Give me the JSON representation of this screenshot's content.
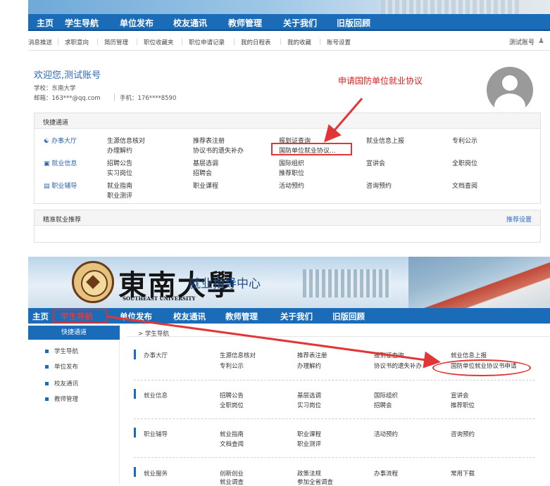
{
  "top": {
    "nav": [
      "主页",
      "学生导航",
      "单位发布",
      "校友通讯",
      "教师管理",
      "关于我们",
      "旧版回顾"
    ],
    "subnav": [
      "消息推送",
      "求职意向",
      "简历管理",
      "职位收藏夹",
      "职位申请记录",
      "我的日程表",
      "我的收藏",
      "账号设置"
    ],
    "account": "测试账号",
    "welcome": "欢迎您,测试账号",
    "school": "学校：东南大学",
    "email": "邮箱：163***@qq.com",
    "phone": "手机：176****8590",
    "annotation": "申请国防单位就业协议",
    "quick": {
      "title": "快捷通道",
      "row1_title": "办事大厅",
      "row1_col1": [
        "生源信息核对",
        "办理解约"
      ],
      "row1_col2": [
        "推荐表注册",
        "协议书的遗失补办"
      ],
      "row1_col3": [
        "报到证查询",
        "国防单位就业协议..."
      ],
      "row1_col4": "就业信息上报",
      "row1_col5": "专利公示",
      "row2_title": "就业信息",
      "row2_col1": [
        "招聘公告",
        "实习岗位"
      ],
      "row2_col2": [
        "基层选调",
        "招聘会"
      ],
      "row2_col3": [
        "国际组织",
        "推荐职位"
      ],
      "row2_col4": "宣讲会",
      "row2_col5": "全职岗位",
      "row3_title": "职业辅导",
      "row3_col1": [
        "就业指南",
        "职业测评"
      ],
      "row3_col2": "职业课程",
      "row3_col3": "活动预约",
      "row3_col4": "咨询预约",
      "row3_col5": "文档查阅"
    },
    "recommend": {
      "title": "精准就业推荐",
      "settings": "推荐设置"
    }
  },
  "bottom": {
    "university_cn": "東南大學",
    "university_en": "SOUTHEAST UNIVERSITY",
    "center": "就业指导中心",
    "nav": [
      "主页",
      "学生导航",
      "单位发布",
      "校友通讯",
      "教师管理",
      "关于我们",
      "旧版回顾"
    ],
    "sidebar_title": "快捷通道",
    "sidebar_items": [
      "学生导航",
      "单位发布",
      "校友通讯",
      "教师管理"
    ],
    "breadcrumb": "> 学生导航",
    "sections": [
      {
        "title": "办事大厅",
        "col1": [
          "生源信息核对",
          "专利公示"
        ],
        "col2": [
          "推荐表注册",
          "办理解约"
        ],
        "col3": [
          "报到证查询",
          "协议书的遗失补办"
        ],
        "col4": [
          "就业信息上报",
          "国防单位就业协议书申请"
        ]
      },
      {
        "title": "就业信息",
        "col1": [
          "招聘公告",
          "全职岗位"
        ],
        "col2": [
          "基层选调",
          "实习岗位"
        ],
        "col3": [
          "国际组织",
          "招聘会"
        ],
        "col4": [
          "宣讲会",
          "推荐职位"
        ]
      },
      {
        "title": "职业辅导",
        "col1": [
          "就业指南",
          "文档查阅"
        ],
        "col2": [
          "职业课程",
          "职业测评"
        ],
        "col3": [
          "活动预约",
          ""
        ],
        "col4": [
          "咨询预约",
          ""
        ]
      },
      {
        "title": "就业服务",
        "col1": [
          "创新创业",
          "就业调查"
        ],
        "col2": [
          "政策法规",
          "参加全省调查"
        ],
        "col3": [
          "办事流程",
          ""
        ],
        "col4": [
          "常用下载",
          ""
        ]
      }
    ]
  },
  "colors": {
    "nav_blue": "#1a6bb8",
    "annotation_red": "#e23636",
    "link_blue": "#2a64b0"
  }
}
